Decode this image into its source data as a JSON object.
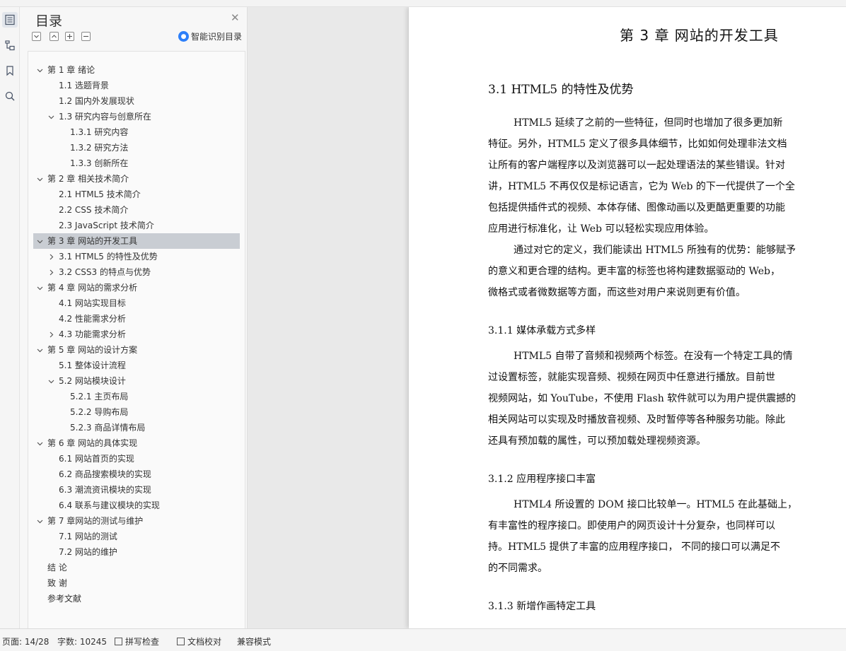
{
  "toc": {
    "title": "目录",
    "smart_label": "智能识别目录",
    "items": [
      {
        "label": "第 1 章  绪论",
        "level": 1,
        "state": "expanded"
      },
      {
        "label": "1.1  选题背景",
        "level": 2,
        "state": "leaf"
      },
      {
        "label": "1.2  国内外发展现状",
        "level": 2,
        "state": "leaf"
      },
      {
        "label": "1.3  研究内容与创意所在",
        "level": 2,
        "state": "expanded"
      },
      {
        "label": "1.3.1  研究内容",
        "level": 3,
        "state": "leaf"
      },
      {
        "label": "1.3.2  研究方法",
        "level": 3,
        "state": "leaf"
      },
      {
        "label": "1.3.3  创新所在",
        "level": 3,
        "state": "leaf"
      },
      {
        "label": "第 2 章  相关技术简介",
        "level": 1,
        "state": "expanded"
      },
      {
        "label": "2.1 HTML5 技术简介",
        "level": 2,
        "state": "leaf"
      },
      {
        "label": "2.2 CSS 技术简介",
        "level": 2,
        "state": "leaf"
      },
      {
        "label": "2.3 JavaScript 技术简介",
        "level": 2,
        "state": "leaf"
      },
      {
        "label": "第 3 章  网站的开发工具",
        "level": 1,
        "state": "expanded",
        "selected": true
      },
      {
        "label": "3.1 HTML5 的特性及优势",
        "level": 2,
        "state": "collapsed"
      },
      {
        "label": "3.2 CSS3 的特点与优势",
        "level": 2,
        "state": "collapsed"
      },
      {
        "label": "第 4 章  网站的需求分析",
        "level": 1,
        "state": "expanded"
      },
      {
        "label": "4.1  网站实现目标",
        "level": 2,
        "state": "leaf"
      },
      {
        "label": "4.2  性能需求分析",
        "level": 2,
        "state": "leaf"
      },
      {
        "label": "4.3  功能需求分析",
        "level": 2,
        "state": "collapsed"
      },
      {
        "label": "第 5 章  网站的设计方案",
        "level": 1,
        "state": "expanded"
      },
      {
        "label": "5.1  整体设计流程",
        "level": 2,
        "state": "leaf"
      },
      {
        "label": "5.2  网站模块设计",
        "level": 2,
        "state": "expanded"
      },
      {
        "label": "5.2.1  主页布局",
        "level": 3,
        "state": "leaf"
      },
      {
        "label": "5.2.2  导购布局",
        "level": 3,
        "state": "leaf"
      },
      {
        "label": "5.2.3  商品详情布局",
        "level": 3,
        "state": "leaf"
      },
      {
        "label": "第 6 章  网站的具体实现",
        "level": 1,
        "state": "expanded"
      },
      {
        "label": "6.1  网站首页的实现",
        "level": 2,
        "state": "leaf"
      },
      {
        "label": "6.2  商品搜索模块的实现",
        "level": 2,
        "state": "leaf"
      },
      {
        "label": "6.3  潮流资讯模块的实现",
        "level": 2,
        "state": "leaf"
      },
      {
        "label": "6.4  联系与建议模块的实现",
        "level": 2,
        "state": "leaf"
      },
      {
        "label": "第 7 章网站的测试与维护",
        "level": 1,
        "state": "expanded"
      },
      {
        "label": "7.1  网站的测试",
        "level": 2,
        "state": "leaf"
      },
      {
        "label": "7.2  网站的维护",
        "level": 2,
        "state": "leaf"
      },
      {
        "label": "结    论",
        "level": 1,
        "state": "leaf"
      },
      {
        "label": "致    谢",
        "level": 1,
        "state": "leaf"
      },
      {
        "label": "参考文献",
        "level": 1,
        "state": "leaf"
      }
    ]
  },
  "document": {
    "chapter_title": "第 3 章  网站的开发工具",
    "h2": "3.1 HTML5 的特性及优势",
    "p1": [
      "HTML5 延续了之前的一些特征，但同时也增加了很多更加新",
      "特征。另外，HTML5 定义了很多具体细节，比如如何处理非法文档",
      "让所有的客户端程序以及浏览器可以一起处理语法的某些错误。针对",
      "讲，HTML5 不再仅仅是标记语言，它为 Web 的下一代提供了一个全",
      "包括提供插件式的视频、本体存储、图像动画以及更酷更重要的功能",
      "应用进行标准化，让 Web 可以轻松实现应用体验。"
    ],
    "p2": [
      "通过对它的定义，我们能读出 HTML5 所独有的优势：能够赋予",
      "的意义和更合理的结构。更丰富的标签也将构建数据驱动的  Web，",
      "微格式或者微数据等方面，而这些对用户来说则更有价值。"
    ],
    "h3_1": "3.1.1  媒体承载方式多样",
    "p3": [
      "HTML5 自带了音频和视频两个标签。在没有一个特定工具的情",
      "过设置标签，就能实现音频、视频在网页中任意进行播放。目前世",
      "视频网站，如 YouTube，不使用 Flash 软件就可以为用户提供震撼的",
      "相关网站可以实现及时播放音视频、及时暂停等各种服务功能。除此",
      "还具有预加载的属性，可以预加载处理视频资源。"
    ],
    "h3_2": "3.1.2  应用程序接口丰富",
    "p4": [
      "HTML4 所设置的 DOM 接口比较单一。HTML5 在此基础上，",
      "有丰富性的程序接口。即使用户的网页设计十分复杂，也同样可以",
      "持。HTML5 提供了丰富的应用程序接口，  不同的接口可以满足不",
      "的不同需求。"
    ],
    "h3_3": "3.1.3  新增作画特定工具"
  },
  "status": {
    "page": "页面: 14/28",
    "words": "字数: 10245",
    "spell": "拼写检查",
    "proof": "文档校对",
    "compat": "兼容模式"
  }
}
